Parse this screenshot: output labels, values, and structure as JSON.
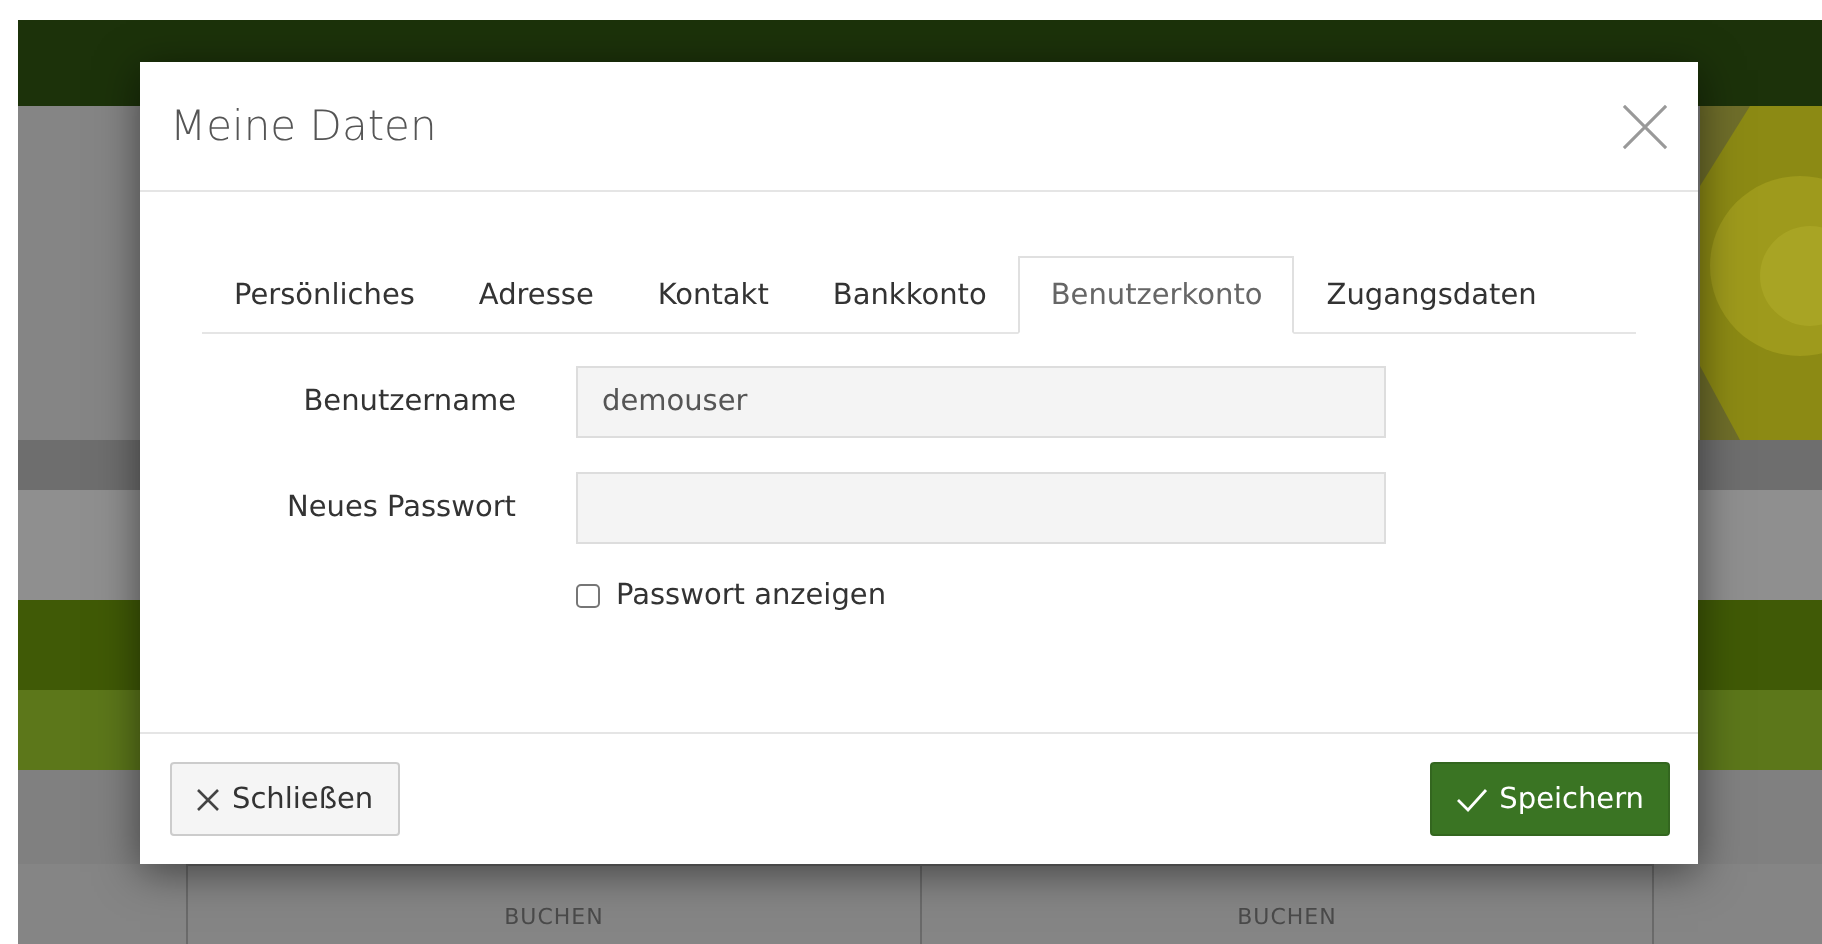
{
  "background": {
    "cells": [
      {
        "label": "BUCHEN"
      },
      {
        "label": "BUCHEN"
      }
    ]
  },
  "modal": {
    "title": "Meine Daten",
    "tabs": [
      {
        "label": "Persönliches",
        "selected": false
      },
      {
        "label": "Adresse",
        "selected": false
      },
      {
        "label": "Kontakt",
        "selected": false
      },
      {
        "label": "Bankkonto",
        "selected": false
      },
      {
        "label": "Benutzerkonto",
        "selected": true
      },
      {
        "label": "Zugangsdaten",
        "selected": false
      }
    ],
    "fields": [
      {
        "label": "Benutzername",
        "value": "demouser"
      },
      {
        "label": "Neues Passwort"
      }
    ],
    "checkbox": {
      "label": "Passwort anzeigen",
      "checked": false
    },
    "buttons": [
      {
        "kind": "close",
        "label": "Schließen"
      },
      {
        "kind": "save",
        "label": "Speichern"
      }
    ]
  }
}
